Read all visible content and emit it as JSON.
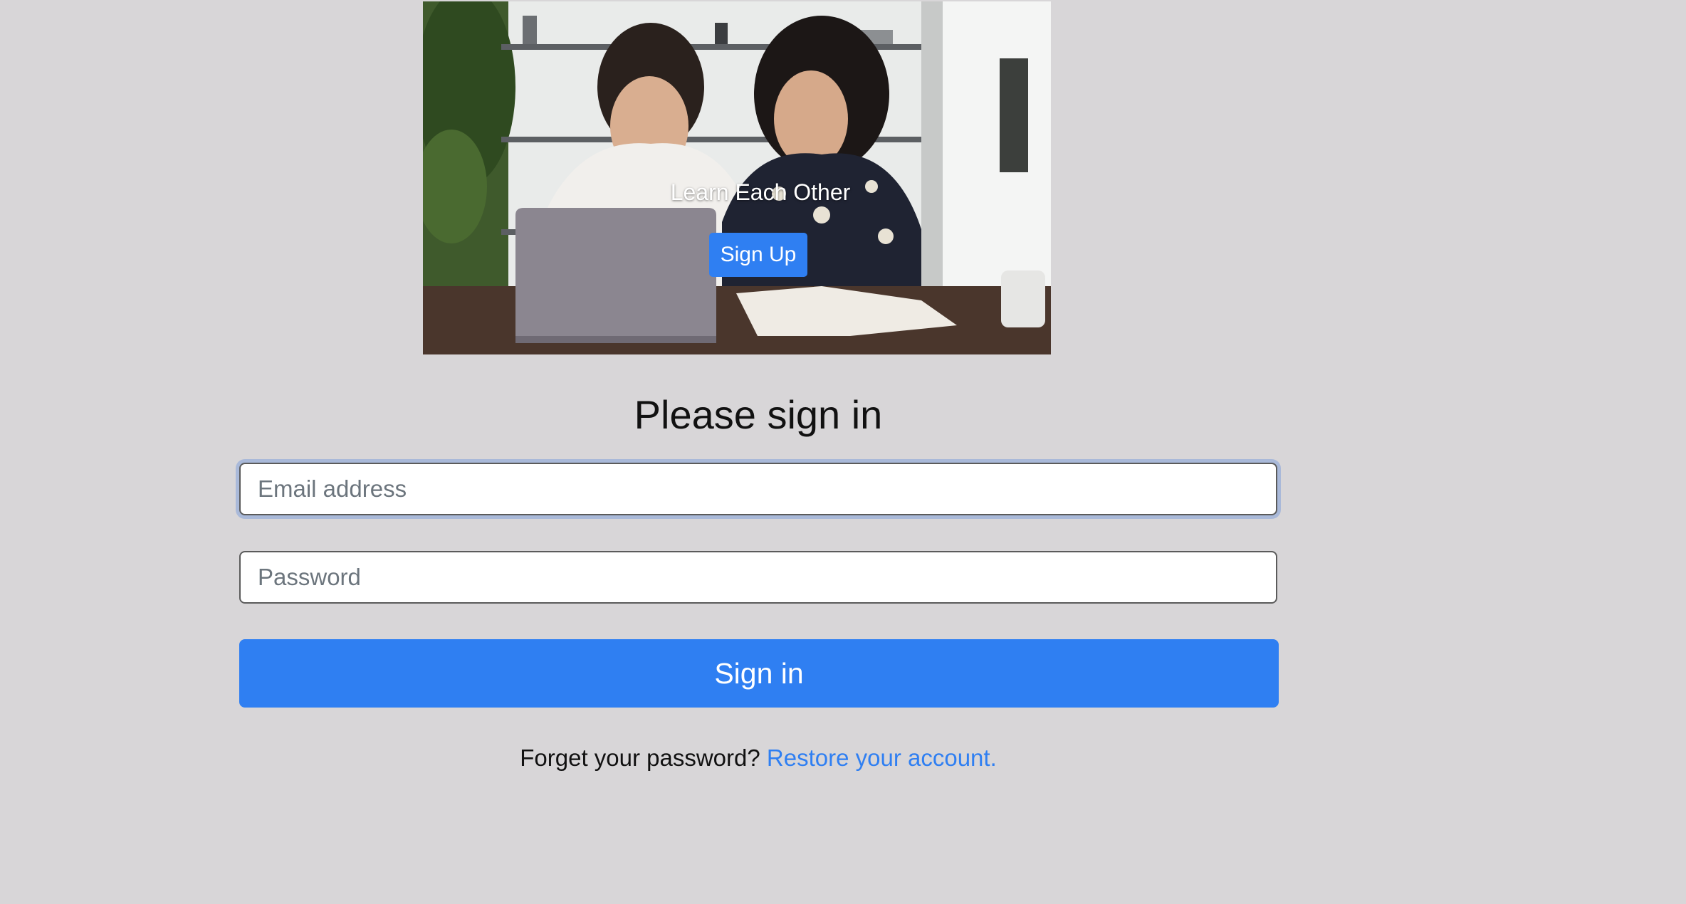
{
  "hero": {
    "tagline": "Learn Each Other",
    "signup_label": "Sign Up"
  },
  "form": {
    "title": "Please sign in",
    "email_placeholder": "Email address",
    "password_placeholder": "Password",
    "submit_label": "Sign in"
  },
  "footer": {
    "prompt": "Forget your password?",
    "link_label": "Restore your account."
  },
  "colors": {
    "background": "#d8d6d8",
    "primary": "#2f7ff2"
  }
}
